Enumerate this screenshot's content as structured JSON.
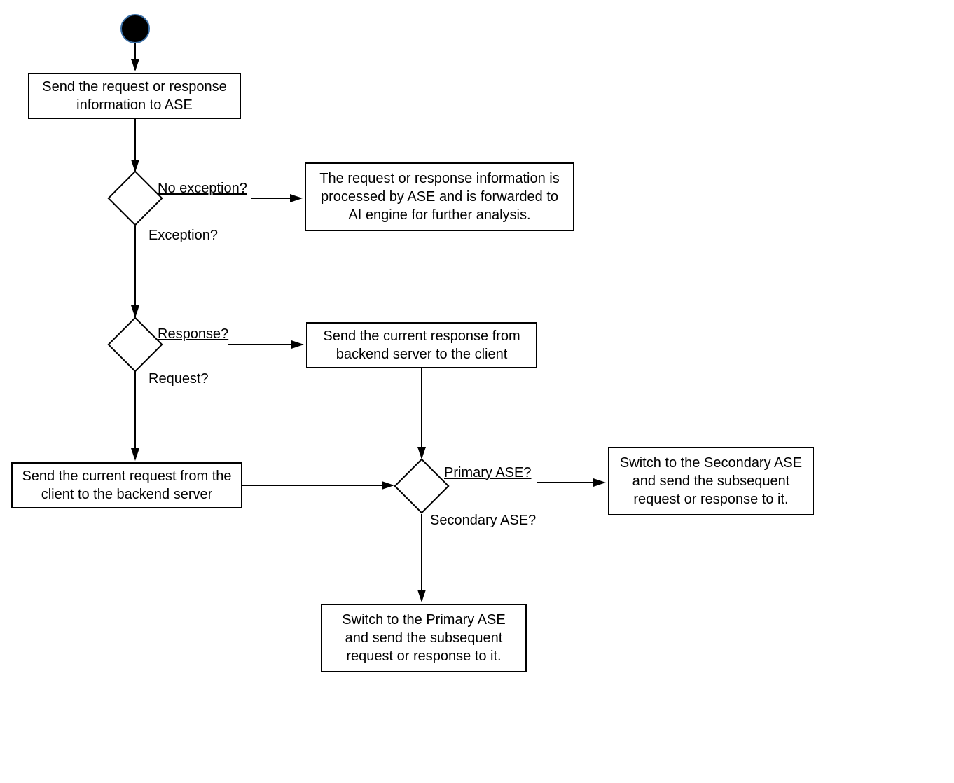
{
  "nodes": {
    "box_send_to_ase": "Send the request or response information to ASE",
    "box_processed_forwarded": "The request or response information is processed by ASE and is forwarded to AI engine for further analysis.",
    "box_send_response_to_client": "Send the current response from backend server to the client",
    "box_send_request_to_backend": "Send the current request from the client to the backend server",
    "box_switch_secondary": "Switch to the Secondary ASE and send the subsequent request or response to it.",
    "box_switch_primary": "Switch to the Primary ASE and send the subsequent request or response to it."
  },
  "labels": {
    "no_exception": "No exception?",
    "exception": "Exception?",
    "response": "Response?",
    "request": "Request?",
    "primary_ase": "Primary ASE?",
    "secondary_ase": "Secondary ASE?"
  }
}
